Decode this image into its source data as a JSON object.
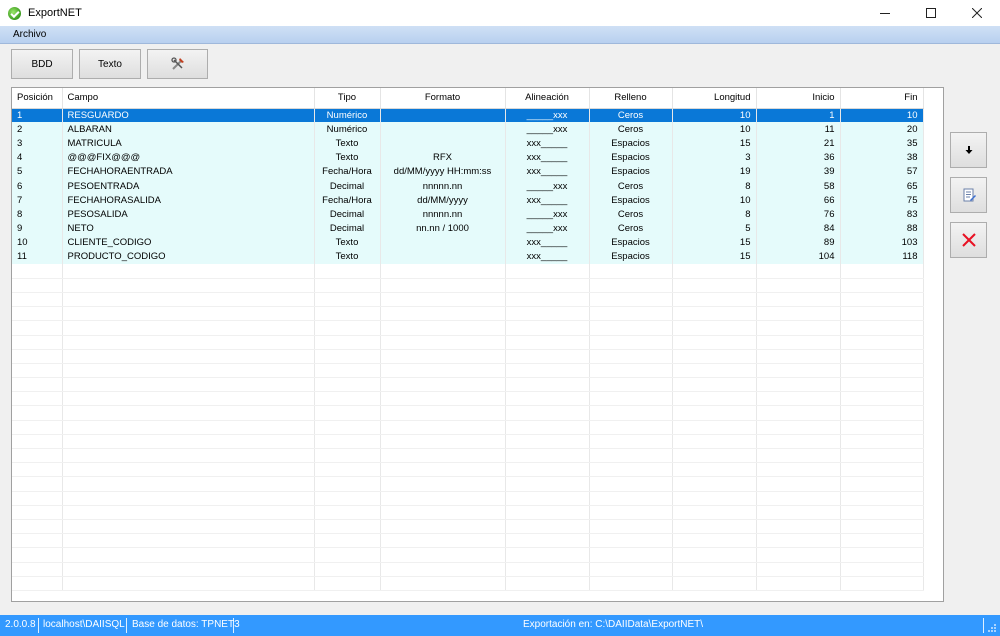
{
  "window": {
    "title": "ExportNET"
  },
  "menu": {
    "archivo": "Archivo"
  },
  "toolbar": {
    "bdd": "BDD",
    "texto": "Texto"
  },
  "table": {
    "headers": [
      "Posición",
      "Campo",
      "Tipo",
      "Formato",
      "Alineación",
      "Relleno",
      "Longitud",
      "Inicio",
      "Fin"
    ],
    "rows": [
      [
        "1",
        "RESGUARDO",
        "Numérico",
        "",
        "_____xxx",
        "Ceros",
        "10",
        "1",
        "10"
      ],
      [
        "2",
        "ALBARAN",
        "Numérico",
        "",
        "_____xxx",
        "Ceros",
        "10",
        "11",
        "20"
      ],
      [
        "3",
        "MATRICULA",
        "Texto",
        "",
        "xxx_____",
        "Espacios",
        "15",
        "21",
        "35"
      ],
      [
        "4",
        "@@@FIX@@@",
        "Texto",
        "RFX",
        "xxx_____",
        "Espacios",
        "3",
        "36",
        "38"
      ],
      [
        "5",
        "FECHAHORAENTRADA",
        "Fecha/Hora",
        "dd/MM/yyyy HH:mm:ss",
        "xxx_____",
        "Espacios",
        "19",
        "39",
        "57"
      ],
      [
        "6",
        "PESOENTRADA",
        "Decimal",
        "nnnnn.nn",
        "_____xxx",
        "Ceros",
        "8",
        "58",
        "65"
      ],
      [
        "7",
        "FECHAHORASALIDA",
        "Fecha/Hora",
        "dd/MM/yyyy",
        "xxx_____",
        "Espacios",
        "10",
        "66",
        "75"
      ],
      [
        "8",
        "PESOSALIDA",
        "Decimal",
        "nnnnn.nn",
        "_____xxx",
        "Ceros",
        "8",
        "76",
        "83"
      ],
      [
        "9",
        "NETO",
        "Decimal",
        "nn.nn / 1000",
        "_____xxx",
        "Ceros",
        "5",
        "84",
        "88"
      ],
      [
        "10",
        "CLIENTE_CODIGO",
        "Texto",
        "",
        "xxx_____",
        "Espacios",
        "15",
        "89",
        "103"
      ],
      [
        "11",
        "PRODUCTO_CODIGO",
        "Texto",
        "",
        "xxx_____",
        "Espacios",
        "15",
        "104",
        "118"
      ]
    ]
  },
  "side_buttons": [
    "arrow-down-icon",
    "document-edit-icon",
    "delete-x-icon"
  ],
  "status": {
    "version": "2.0.0.8",
    "server": "localhost\\DAIISQL",
    "database": "Base de datos: TPNET3",
    "export_path": "Exportación en: C:\\DAIIData\\ExportNET\\"
  },
  "colors": {
    "selection": "#0a78d7",
    "row_bg": "#e5fbfb",
    "statusbar": "#3399ff",
    "menubar": "#c4d8f2",
    "delete": "#e81123"
  }
}
